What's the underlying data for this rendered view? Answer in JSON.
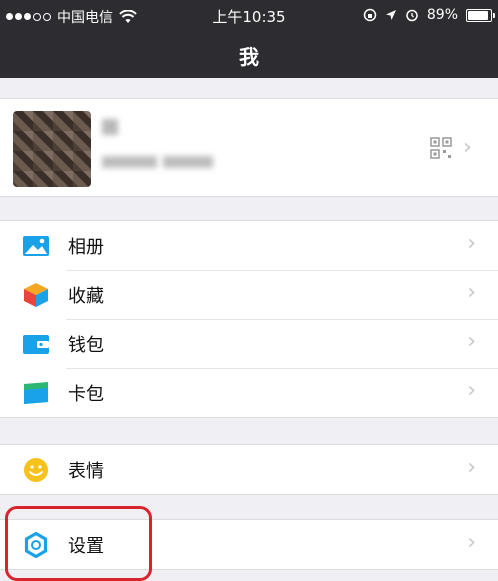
{
  "status_bar": {
    "carrier": "中国电信",
    "time": "上午10:35",
    "battery_percent": "89%",
    "battery_level": 0.89
  },
  "nav": {
    "title": "我"
  },
  "profile": {
    "qr_icon": "qr-code-icon"
  },
  "menu_group_1": [
    {
      "label": "相册",
      "icon": "photo-album-icon",
      "color": "#1aa2e8"
    },
    {
      "label": "收藏",
      "icon": "favorites-cube-icon",
      "color": "#f5a623"
    },
    {
      "label": "钱包",
      "icon": "wallet-icon",
      "color": "#1aa2e8"
    },
    {
      "label": "卡包",
      "icon": "card-pack-icon",
      "color": "#2bb673"
    }
  ],
  "menu_group_2": [
    {
      "label": "表情",
      "icon": "emoji-smile-icon",
      "color": "#f7c21b"
    }
  ],
  "menu_group_3": [
    {
      "label": "设置",
      "icon": "settings-gear-icon",
      "color": "#1aa2e8"
    }
  ],
  "annotation": {
    "highlight_color": "#d8252d"
  }
}
